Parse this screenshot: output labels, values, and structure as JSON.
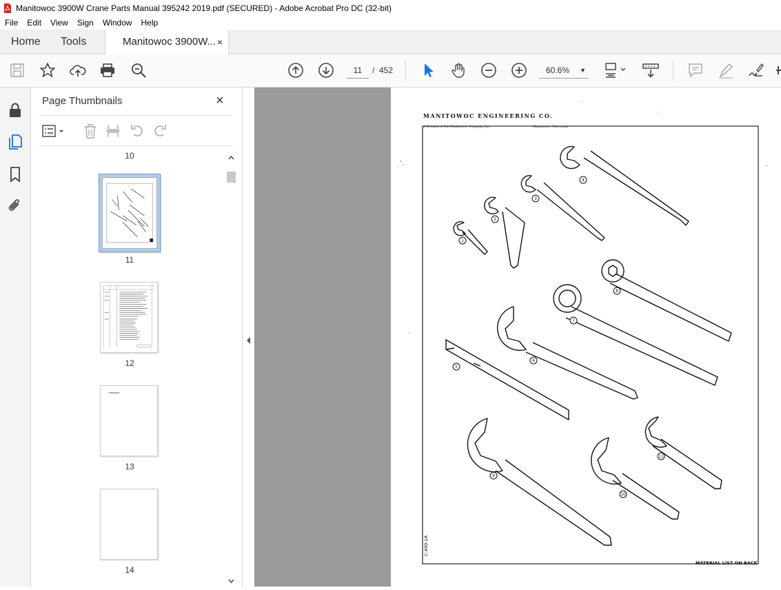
{
  "window": {
    "title": "Manitowoc 3900W Crane Parts Manual 395242 2019.pdf (SECURED) - Adobe Acrobat Pro DC (32-bit)"
  },
  "menu": [
    "File",
    "Edit",
    "View",
    "Sign",
    "Window",
    "Help"
  ],
  "tabs": {
    "home": "Home",
    "tools": "Tools",
    "document": "Manitowoc 3900W...",
    "close_symbol": "×"
  },
  "toolbar": {
    "icons": [
      "save-icon",
      "star-icon",
      "upload-icon",
      "print-icon",
      "search-zoom-icon",
      "page-up-icon",
      "page-down-icon",
      "select-cursor-icon",
      "hand-icon",
      "zoom-out-icon",
      "zoom-in-icon",
      "fit-page-icon",
      "scroll-mode-icon",
      "comment-icon",
      "highlight-icon",
      "sign-icon"
    ],
    "current_page": "11",
    "page_separator": "/",
    "total_pages": "452",
    "zoom": "60.6%"
  },
  "accent_color": "#1473e6",
  "panel": {
    "title": "Page Thumbnails",
    "close_symbol": "×",
    "thumbnails": [
      {
        "label": "10"
      },
      {
        "label": "11",
        "selected": true
      },
      {
        "label": "12"
      },
      {
        "label": "13"
      },
      {
        "label": "14"
      }
    ]
  },
  "document": {
    "header": "MANITOWOC ENGINEERING CO.",
    "subheader_left": "A Division of the Manitowoc Company, Inc.",
    "subheader_right": "Manitowoc, Wisconsin",
    "side_code": "C-480-1A",
    "footer": "MATERIAL LIST ON BACK",
    "callouts": [
      "1",
      "2",
      "3",
      "4",
      "5",
      "6",
      "7",
      "8",
      "9",
      "10",
      "11"
    ]
  }
}
